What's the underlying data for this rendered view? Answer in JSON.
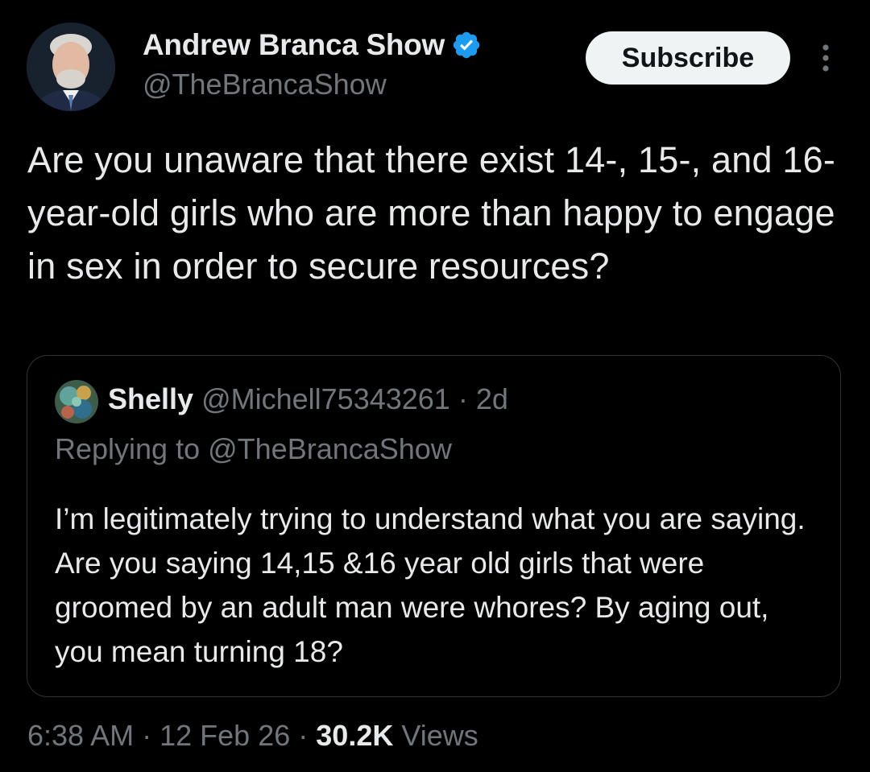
{
  "author": {
    "name": "Andrew Branca Show",
    "handle": "@TheBrancaShow",
    "verified": true
  },
  "subscribe_label": "Subscribe",
  "tweet": {
    "text": "Are you unaware that there exist 14-, 15-, and 16-year-old girls who are more than happy to engage in sex in order to secure resources?"
  },
  "quote": {
    "name": "Shelly",
    "handle": "@Michell75343261",
    "separator": "·",
    "age": "2d",
    "replying_prefix": "Replying to",
    "replying_handle": "@TheBrancaShow",
    "text": "I’m legitimately trying to understand what you are saying. Are you saying 14,15 &16 year old girls that were groomed by an adult man were whores? By aging out, you mean turning 18?"
  },
  "meta": {
    "time": "6:38 AM",
    "date": "12 Feb 26",
    "separator": "·",
    "views_count": "30.2K",
    "views_label": "Views"
  },
  "colors": {
    "background": "#000000",
    "text_primary": "#e7e9ea",
    "text_secondary": "#71767b",
    "verified_blue": "#1d9bf0",
    "border": "#2f3336",
    "button_bg": "#eff3f4"
  }
}
